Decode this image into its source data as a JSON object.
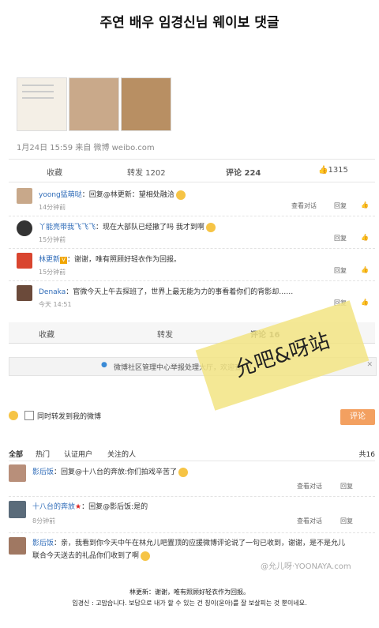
{
  "page_title": "주연 배우 임경신님 웨이보 댓글",
  "post": {
    "date_line": "1月24日 15:59 来自 微博 weibo.com"
  },
  "stats1": {
    "collect": "收藏",
    "repost": "转发 1202",
    "comment": "评论 224",
    "like": "1315"
  },
  "comments1": [
    {
      "name": "yoong猛萌哒",
      "text": "：回复@林更新：望相处融洽",
      "time": "14分钟前",
      "actions": [
        "查看对话",
        "回复"
      ]
    },
    {
      "name": "丫能亮带我飞飞飞",
      "text": "：现在大部队已经撤了吗 我才到啊",
      "time": "15分钟前",
      "actions": [
        "回复"
      ]
    },
    {
      "name": "林更新",
      "text": "：谢谢，唯有照顾好轻衣作为回报。",
      "time": "15分钟前",
      "actions": [
        "回复"
      ]
    },
    {
      "name": "Denaka",
      "text": "：官微今天上午去探班了，世界上最无能为力的事看着你们的背影却……",
      "time": "今天 14:51",
      "actions": [
        "回复"
      ]
    }
  ],
  "stats2": {
    "collect": "收藏",
    "repost": "转发",
    "comment": "评论 16"
  },
  "notice": "微博社区管理中心举报处理大厅，欢迎查阅！",
  "compose": {
    "checkbox_label": "同时转发到我的微博",
    "submit": "评论"
  },
  "filters": {
    "all": "全部",
    "hot": "热门",
    "verified": "认证用户",
    "followed": "关注的人",
    "count": "共16"
  },
  "comments2": [
    {
      "name": "影后饭",
      "text": "：回复@十八台的奔放:你们拍戏辛苦了",
      "time": "",
      "actions": [
        "查看对话",
        "回复"
      ]
    },
    {
      "name": "十八台的奔放",
      "text": "：回复@影后饭:是的",
      "time": "8分钟前",
      "actions": [
        "查看对话",
        "回复"
      ]
    },
    {
      "name": "影后饭",
      "text": "：亲，我看到你今天中午在林允儿吧置顶的应援微博评论说了一句已收到，谢谢，是不是允儿",
      "text2": "联合今天送去的礼品你们收到了啊",
      "time": "",
      "actions": []
    }
  ],
  "tape_text": "允吧&呀站",
  "watermark": "@允儿呀·YOONAYA.com",
  "footer": {
    "line1": "林更新：谢谢，唯有照顾好轻衣作为回报。",
    "line2": "임경신 : 고맙습니다. 보답으로 내가 할 수 있는 건 칭이(윤아)를 잘 보살피는 것 뿐이네요."
  },
  "colors": {
    "link": "#2e6bb8",
    "tape": "#f2e482",
    "button": "#f3a060"
  }
}
